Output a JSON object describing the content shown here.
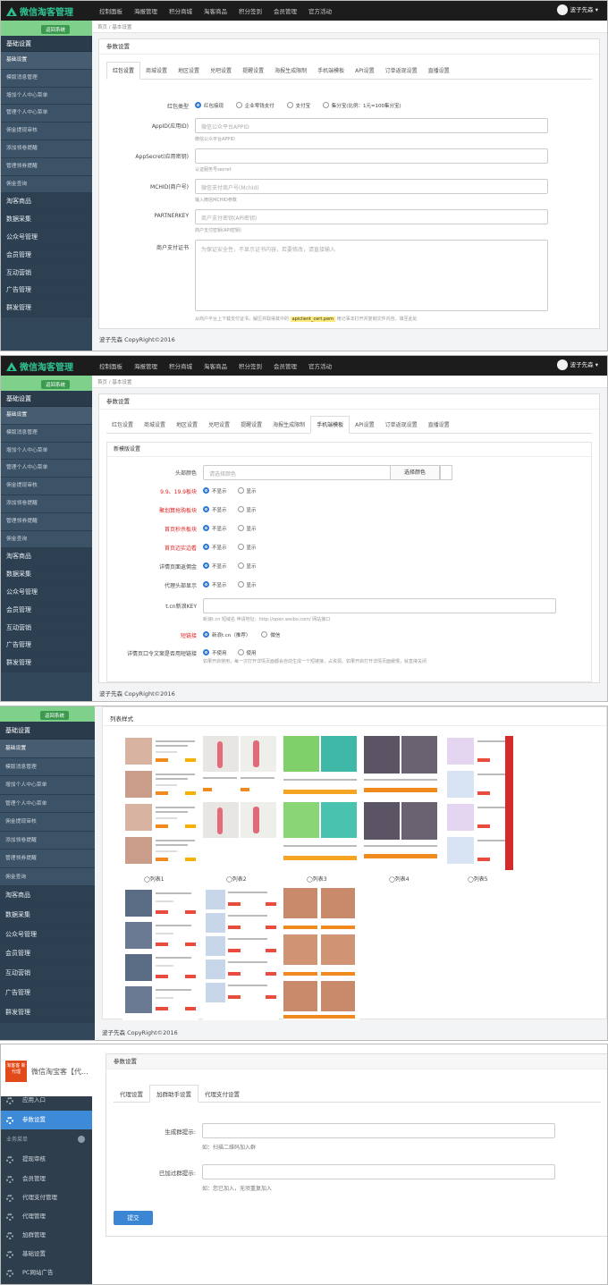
{
  "topnav": {
    "logo": "微信淘客管理",
    "items": [
      "控制面板",
      "海报管理",
      "积分商城",
      "淘客商品",
      "积分签到",
      "会员管理",
      "官方活动"
    ],
    "user": "波子先森"
  },
  "sidebar": {
    "back": "返回系统",
    "group_basic": "基础设置",
    "sub_items": [
      "基础设置",
      "模版消息管理",
      "增加个人中心菜单",
      "管理个人中心菜单",
      "佣金提现审核",
      "添加领卷提醒",
      "管理领券提醒",
      "佣金查询"
    ],
    "sections": [
      "淘客商品",
      "数据采集",
      "公众号管理",
      "会员管理",
      "互动营销",
      "广告管理",
      "群发管理"
    ]
  },
  "breadcrumb": {
    "home": "首页",
    "sep": "/",
    "current": "基本设置"
  },
  "box_title": "参数设置",
  "tabs": [
    "红包设置",
    "商城设置",
    "地区设置",
    "兑吧设置",
    "提醒设置",
    "海报生成限制",
    "手机端模板",
    "API设置",
    "订单返现设置",
    "直播设置"
  ],
  "panel1": {
    "rows": [
      {
        "label": "红包类型",
        "options": [
          "红包接现",
          "企业零钱支付",
          "支付宝",
          "集分宝(比例：1元=100集分宝)"
        ]
      },
      {
        "label": "AppID(应用ID)",
        "placeholder": "微信公众平台APPID",
        "tip": "微信公众平台APPID"
      },
      {
        "label": "AppSecret(应用密钥)",
        "placeholder": "",
        "tip": "认证服务号secret"
      },
      {
        "label": "MCHID(商户号)",
        "placeholder": "微信支付商户号(MchId)",
        "tip": "输入微信MCHID参数"
      },
      {
        "label": "PARTNERKEY",
        "placeholder": "商户支付密钥(API密钥)",
        "tip": "商户支付密钥(API密钥)"
      },
      {
        "label": "商户支付证书",
        "placeholder": "为保证安全性，不显示证书内容，若要修改，请直接输入"
      }
    ],
    "cert_tip_a": "从商户平台上下载支付证书，解压并取得其中的",
    "cert_file": "apiclient_cert.pem",
    "cert_tip_b": "用记事本打开并复制文件内容，填至此处"
  },
  "footer": "波子先森 CopyRight©2016",
  "panel2": {
    "inner_title": "新模版设置",
    "header_color_label": "头部颜色",
    "header_color_placeholder": "请选择颜色",
    "choose_color": "选择颜色",
    "show": "显示",
    "hide": "不显示",
    "toggles": [
      {
        "label": "9.9、19.9板块",
        "red": true
      },
      {
        "label": "聚划算抢购板块",
        "red": true
      },
      {
        "label": "首页秒杀板块",
        "red": true
      },
      {
        "label": "首页迈实边看",
        "red": true
      },
      {
        "label": "详情页面返佣金",
        "red": false
      },
      {
        "label": "代理头部显示",
        "red": false
      }
    ],
    "tcn_label": "t.cn新浪KEY",
    "tcn_tip": "新浪t.cn 短域名 申请地址：http://open.weibo.com/ 网站接口",
    "short_label": "短链接",
    "short_opts": [
      "新浪t.cn（推荐）",
      "微信"
    ],
    "qr_label": "详情页口令文案是否用短链接",
    "qr_opts": [
      "不使用",
      "使用"
    ],
    "qr_tip": "如果开启使用，每一次打开详情页面都会自动生成一个短链接，占资源。如果开启打开详情页面缓慢，就直接关闭"
  },
  "panel3": {
    "title": "列表样式",
    "labels": [
      "◯列表1",
      "◯列表2",
      "◯列表3",
      "◯列表4",
      "◯列表5"
    ]
  },
  "panel4": {
    "brand_logo": "淘客客 新代理",
    "brand_title": "微信淘宝客【代...",
    "menu": [
      {
        "label": "应用入口",
        "kind": "item"
      },
      {
        "label": "参数设置",
        "kind": "active"
      },
      {
        "label": "业务菜单",
        "kind": "group"
      },
      {
        "label": "提现审核",
        "kind": "item"
      },
      {
        "label": "会员管理",
        "kind": "item"
      },
      {
        "label": "代理支付管理",
        "kind": "item"
      },
      {
        "label": "代理管理",
        "kind": "item"
      },
      {
        "label": "加群管理",
        "kind": "item"
      },
      {
        "label": "基础设置",
        "kind": "item"
      },
      {
        "label": "PC网站广告",
        "kind": "item"
      }
    ],
    "box_title": "参数设置",
    "tabs": [
      "代理设置",
      "加群助手设置",
      "代理支付设置"
    ],
    "rows": [
      {
        "label": "生成群提示:",
        "tip": "如：扫描二维码加入群"
      },
      {
        "label": "已加过群提示:",
        "tip": "如：您已加入，无须重复加入"
      }
    ],
    "submit": "提交"
  }
}
